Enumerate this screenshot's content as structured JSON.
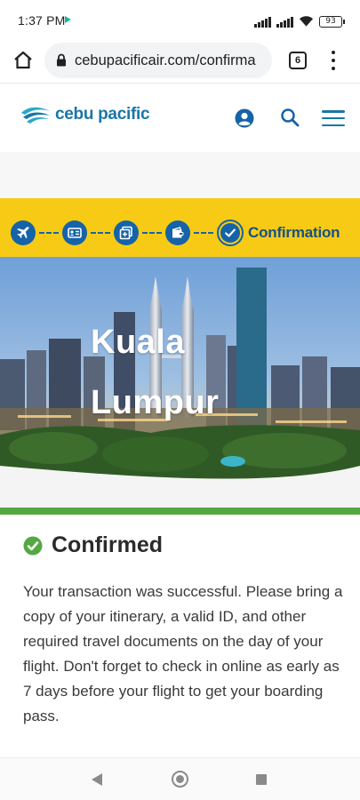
{
  "status_bar": {
    "time": "1:37 PM",
    "battery": "93"
  },
  "browser": {
    "url": "cebupacificair.com/confirma",
    "tab_count": "6"
  },
  "site": {
    "logo_text": "cebu pacific",
    "brand_color": "#1976a8"
  },
  "progress": {
    "steps": [
      {
        "icon": "airplane-icon"
      },
      {
        "icon": "passenger-card-icon"
      },
      {
        "icon": "add-ons-icon"
      },
      {
        "icon": "wallet-icon"
      },
      {
        "icon": "checkmark-icon",
        "label": "Confirmation",
        "current": true
      }
    ],
    "band_color": "#f7cb15"
  },
  "hero": {
    "destination_line1": "Kuala",
    "destination_line2": "Lumpur"
  },
  "confirmation": {
    "title": "Confirmed",
    "message": "Your transaction was successful. Please bring a copy of your itinerary, a valid ID, and other required travel documents on the day of your flight. Don't forget to check in online as early as 7 days before your flight to get your boarding pass.",
    "status_color": "#54a843"
  }
}
